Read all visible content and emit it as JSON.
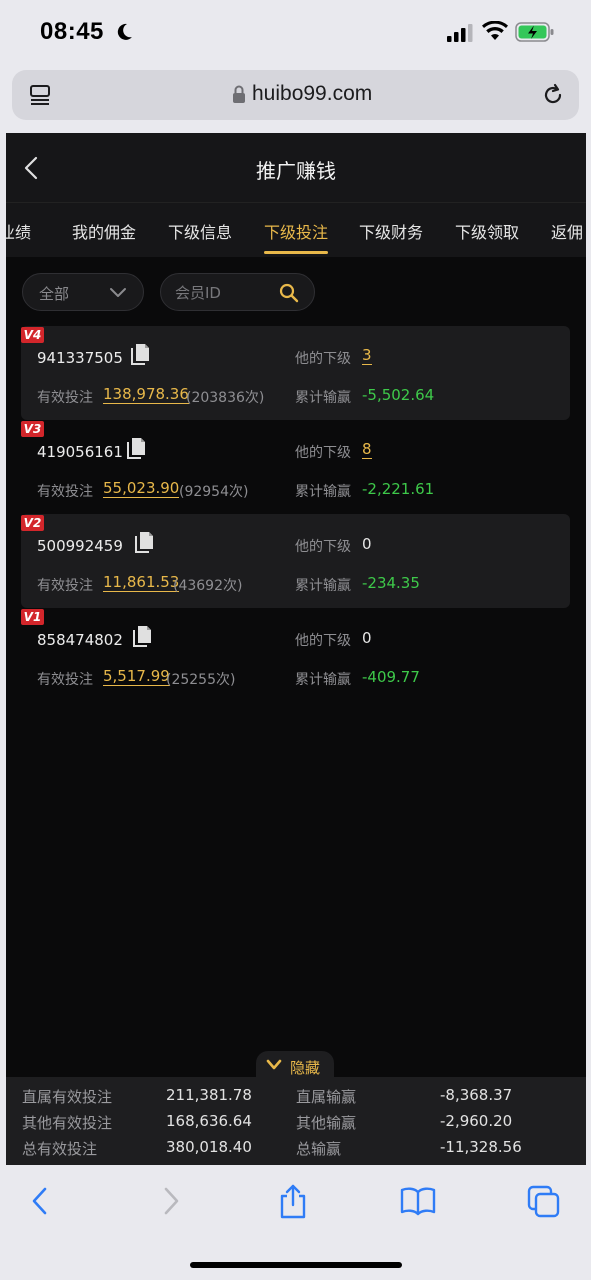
{
  "status_bar": {
    "time": "08:45"
  },
  "browser": {
    "url": "huibo99.com"
  },
  "header": {
    "title": "推广赚钱"
  },
  "tabs": [
    {
      "label": "业绩"
    },
    {
      "label": "我的佣金"
    },
    {
      "label": "下级信息"
    },
    {
      "label": "下级投注",
      "active": true
    },
    {
      "label": "下级财务"
    },
    {
      "label": "下级领取"
    },
    {
      "label": "返佣"
    }
  ],
  "filter": {
    "selected": "全部",
    "search_placeholder": "会员ID"
  },
  "field_labels": {
    "subordinates": "他的下级",
    "valid_bet": "有效投注",
    "cumulative_win_loss": "累计输赢"
  },
  "members": [
    {
      "level": "V4",
      "id": "941337505",
      "subordinates": "3",
      "valid_bet": "138,978.36",
      "bet_count": "(203836次)",
      "win_loss": "-5,502.64"
    },
    {
      "level": "V3",
      "id": "419056161",
      "subordinates": "8",
      "valid_bet": "55,023.90",
      "bet_count": "(92954次)",
      "win_loss": "-2,221.61"
    },
    {
      "level": "V2",
      "id": "500992459",
      "subordinates": "0",
      "valid_bet": "11,861.53",
      "bet_count": "(43692次)",
      "win_loss": "-234.35"
    },
    {
      "level": "V1",
      "id": "858474802",
      "subordinates": "0",
      "valid_bet": "5,517.99",
      "bet_count": "(25255次)",
      "win_loss": "-409.77"
    }
  ],
  "hide_toggle": {
    "label": "隐藏"
  },
  "summary": {
    "direct_valid_bet_label": "直属有效投注",
    "direct_valid_bet": "211,381.78",
    "direct_win_loss_label": "直属输赢",
    "direct_win_loss": "-8,368.37",
    "other_valid_bet_label": "其他有效投注",
    "other_valid_bet": "168,636.64",
    "other_win_loss_label": "其他输赢",
    "other_win_loss": "-2,960.20",
    "total_valid_bet_label": "总有效投注",
    "total_valid_bet": "380,018.40",
    "total_win_loss_label": "总输赢",
    "total_win_loss": "-11,328.56"
  },
  "colors": {
    "accent": "#e8b84a",
    "loss": "#3ec94a",
    "badge": "#d3262b"
  },
  "icons": [
    "moon-icon",
    "signal-icon",
    "wifi-icon",
    "battery-icon",
    "tab-icon",
    "lock-icon",
    "reload-icon",
    "back-icon",
    "chevron-down-icon",
    "search-icon",
    "copy-icon",
    "share-icon",
    "bookmarks-icon",
    "tabs-icon"
  ]
}
